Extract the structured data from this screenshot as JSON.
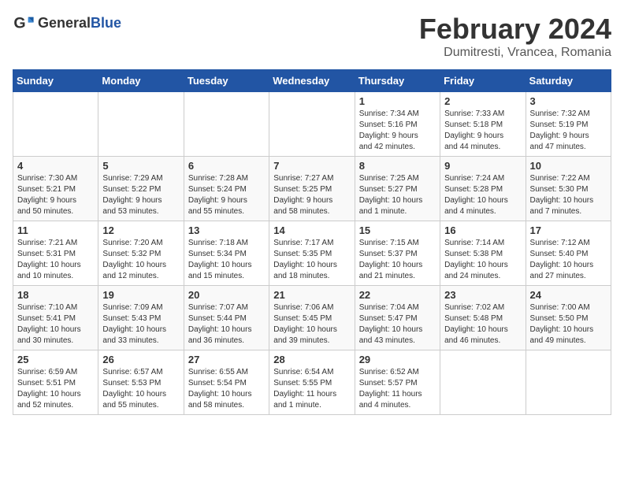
{
  "logo": {
    "text_general": "General",
    "text_blue": "Blue"
  },
  "title": "February 2024",
  "subtitle": "Dumitresti, Vrancea, Romania",
  "days_of_week": [
    "Sunday",
    "Monday",
    "Tuesday",
    "Wednesday",
    "Thursday",
    "Friday",
    "Saturday"
  ],
  "weeks": [
    [
      {
        "day": "",
        "info": ""
      },
      {
        "day": "",
        "info": ""
      },
      {
        "day": "",
        "info": ""
      },
      {
        "day": "",
        "info": ""
      },
      {
        "day": "1",
        "info": "Sunrise: 7:34 AM\nSunset: 5:16 PM\nDaylight: 9 hours\nand 42 minutes."
      },
      {
        "day": "2",
        "info": "Sunrise: 7:33 AM\nSunset: 5:18 PM\nDaylight: 9 hours\nand 44 minutes."
      },
      {
        "day": "3",
        "info": "Sunrise: 7:32 AM\nSunset: 5:19 PM\nDaylight: 9 hours\nand 47 minutes."
      }
    ],
    [
      {
        "day": "4",
        "info": "Sunrise: 7:30 AM\nSunset: 5:21 PM\nDaylight: 9 hours\nand 50 minutes."
      },
      {
        "day": "5",
        "info": "Sunrise: 7:29 AM\nSunset: 5:22 PM\nDaylight: 9 hours\nand 53 minutes."
      },
      {
        "day": "6",
        "info": "Sunrise: 7:28 AM\nSunset: 5:24 PM\nDaylight: 9 hours\nand 55 minutes."
      },
      {
        "day": "7",
        "info": "Sunrise: 7:27 AM\nSunset: 5:25 PM\nDaylight: 9 hours\nand 58 minutes."
      },
      {
        "day": "8",
        "info": "Sunrise: 7:25 AM\nSunset: 5:27 PM\nDaylight: 10 hours\nand 1 minute."
      },
      {
        "day": "9",
        "info": "Sunrise: 7:24 AM\nSunset: 5:28 PM\nDaylight: 10 hours\nand 4 minutes."
      },
      {
        "day": "10",
        "info": "Sunrise: 7:22 AM\nSunset: 5:30 PM\nDaylight: 10 hours\nand 7 minutes."
      }
    ],
    [
      {
        "day": "11",
        "info": "Sunrise: 7:21 AM\nSunset: 5:31 PM\nDaylight: 10 hours\nand 10 minutes."
      },
      {
        "day": "12",
        "info": "Sunrise: 7:20 AM\nSunset: 5:32 PM\nDaylight: 10 hours\nand 12 minutes."
      },
      {
        "day": "13",
        "info": "Sunrise: 7:18 AM\nSunset: 5:34 PM\nDaylight: 10 hours\nand 15 minutes."
      },
      {
        "day": "14",
        "info": "Sunrise: 7:17 AM\nSunset: 5:35 PM\nDaylight: 10 hours\nand 18 minutes."
      },
      {
        "day": "15",
        "info": "Sunrise: 7:15 AM\nSunset: 5:37 PM\nDaylight: 10 hours\nand 21 minutes."
      },
      {
        "day": "16",
        "info": "Sunrise: 7:14 AM\nSunset: 5:38 PM\nDaylight: 10 hours\nand 24 minutes."
      },
      {
        "day": "17",
        "info": "Sunrise: 7:12 AM\nSunset: 5:40 PM\nDaylight: 10 hours\nand 27 minutes."
      }
    ],
    [
      {
        "day": "18",
        "info": "Sunrise: 7:10 AM\nSunset: 5:41 PM\nDaylight: 10 hours\nand 30 minutes."
      },
      {
        "day": "19",
        "info": "Sunrise: 7:09 AM\nSunset: 5:43 PM\nDaylight: 10 hours\nand 33 minutes."
      },
      {
        "day": "20",
        "info": "Sunrise: 7:07 AM\nSunset: 5:44 PM\nDaylight: 10 hours\nand 36 minutes."
      },
      {
        "day": "21",
        "info": "Sunrise: 7:06 AM\nSunset: 5:45 PM\nDaylight: 10 hours\nand 39 minutes."
      },
      {
        "day": "22",
        "info": "Sunrise: 7:04 AM\nSunset: 5:47 PM\nDaylight: 10 hours\nand 43 minutes."
      },
      {
        "day": "23",
        "info": "Sunrise: 7:02 AM\nSunset: 5:48 PM\nDaylight: 10 hours\nand 46 minutes."
      },
      {
        "day": "24",
        "info": "Sunrise: 7:00 AM\nSunset: 5:50 PM\nDaylight: 10 hours\nand 49 minutes."
      }
    ],
    [
      {
        "day": "25",
        "info": "Sunrise: 6:59 AM\nSunset: 5:51 PM\nDaylight: 10 hours\nand 52 minutes."
      },
      {
        "day": "26",
        "info": "Sunrise: 6:57 AM\nSunset: 5:53 PM\nDaylight: 10 hours\nand 55 minutes."
      },
      {
        "day": "27",
        "info": "Sunrise: 6:55 AM\nSunset: 5:54 PM\nDaylight: 10 hours\nand 58 minutes."
      },
      {
        "day": "28",
        "info": "Sunrise: 6:54 AM\nSunset: 5:55 PM\nDaylight: 11 hours\nand 1 minute."
      },
      {
        "day": "29",
        "info": "Sunrise: 6:52 AM\nSunset: 5:57 PM\nDaylight: 11 hours\nand 4 minutes."
      },
      {
        "day": "",
        "info": ""
      },
      {
        "day": "",
        "info": ""
      }
    ]
  ]
}
